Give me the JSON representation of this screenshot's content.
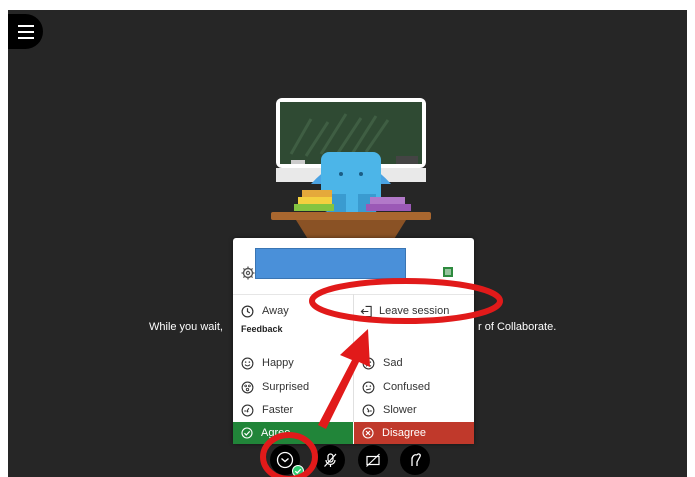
{
  "wait_message": {
    "left": "While you wait,",
    "right": "r of Collaborate."
  },
  "status_menu": {
    "away": "Away",
    "leave_session": "Leave session",
    "feedback_heading": "Feedback",
    "left_options": [
      "Happy",
      "Surprised",
      "Faster"
    ],
    "right_options": [
      "Sad",
      "Confused",
      "Slower"
    ],
    "agree": "Agree",
    "disagree": "Disagree"
  },
  "colors": {
    "stage": "#262626",
    "agree": "#218539",
    "disagree": "#c0392b",
    "annotation": "#e11a1a",
    "name_bar": "#4a90d9"
  },
  "icons": [
    "menu-icon",
    "settings-icon",
    "clock-icon",
    "leave-icon",
    "happy-icon",
    "sad-icon",
    "surprised-icon",
    "confused-icon",
    "faster-icon",
    "slower-icon",
    "agree-icon",
    "disagree-icon",
    "status-icon",
    "mic-off-icon",
    "camera-off-icon",
    "raise-hand-icon"
  ]
}
